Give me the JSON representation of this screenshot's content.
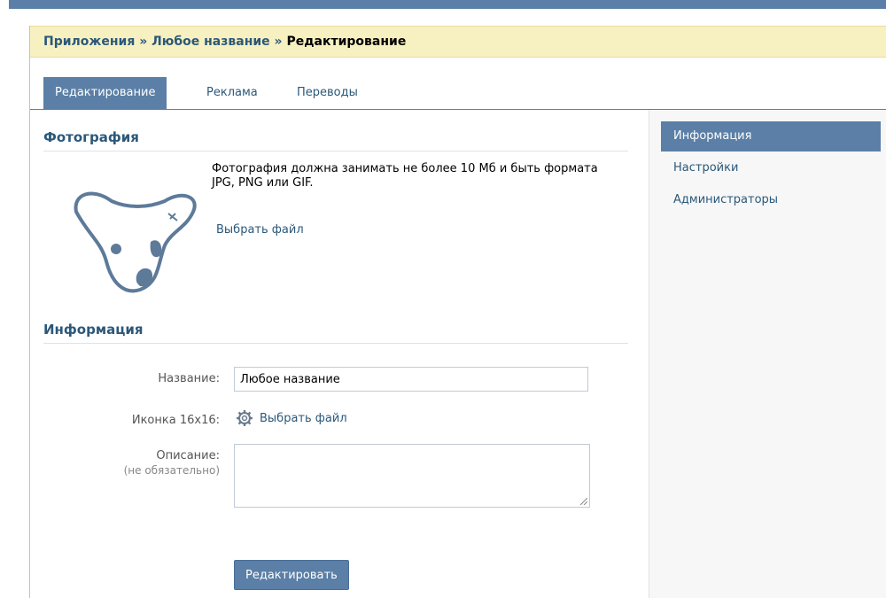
{
  "breadcrumb": {
    "item1": "Приложения",
    "sep": "»",
    "item2": "Любое название",
    "current": "Редактирование"
  },
  "tabs": [
    {
      "label": "Редактирование",
      "active": true
    },
    {
      "label": "Реклама",
      "active": false
    },
    {
      "label": "Переводы",
      "active": false
    }
  ],
  "sidebar": {
    "items": [
      {
        "label": "Информация",
        "active": true
      },
      {
        "label": "Настройки",
        "active": false
      },
      {
        "label": "Администраторы",
        "active": false
      }
    ]
  },
  "photo": {
    "title": "Фотография",
    "description": "Фотография должна занимать не более 10 Мб и быть формата JPG, PNG или GIF.",
    "choose_file": "Выбрать файл",
    "avatar_icon": "vk-dog-placeholder-icon"
  },
  "info": {
    "title": "Информация",
    "name_label": "Название:",
    "name_value": "Любое название",
    "icon_label": "Иконка 16x16:",
    "icon_choose": "Выбрать файл",
    "icon_name": "gear-icon",
    "description_label": "Описание:",
    "description_hint": "(не обязательно)",
    "description_value": ""
  },
  "submit_label": "Редактировать",
  "colors": {
    "accent": "#5b7fa6",
    "link": "#2b587a",
    "crumb_bg": "#f7f1c1"
  }
}
